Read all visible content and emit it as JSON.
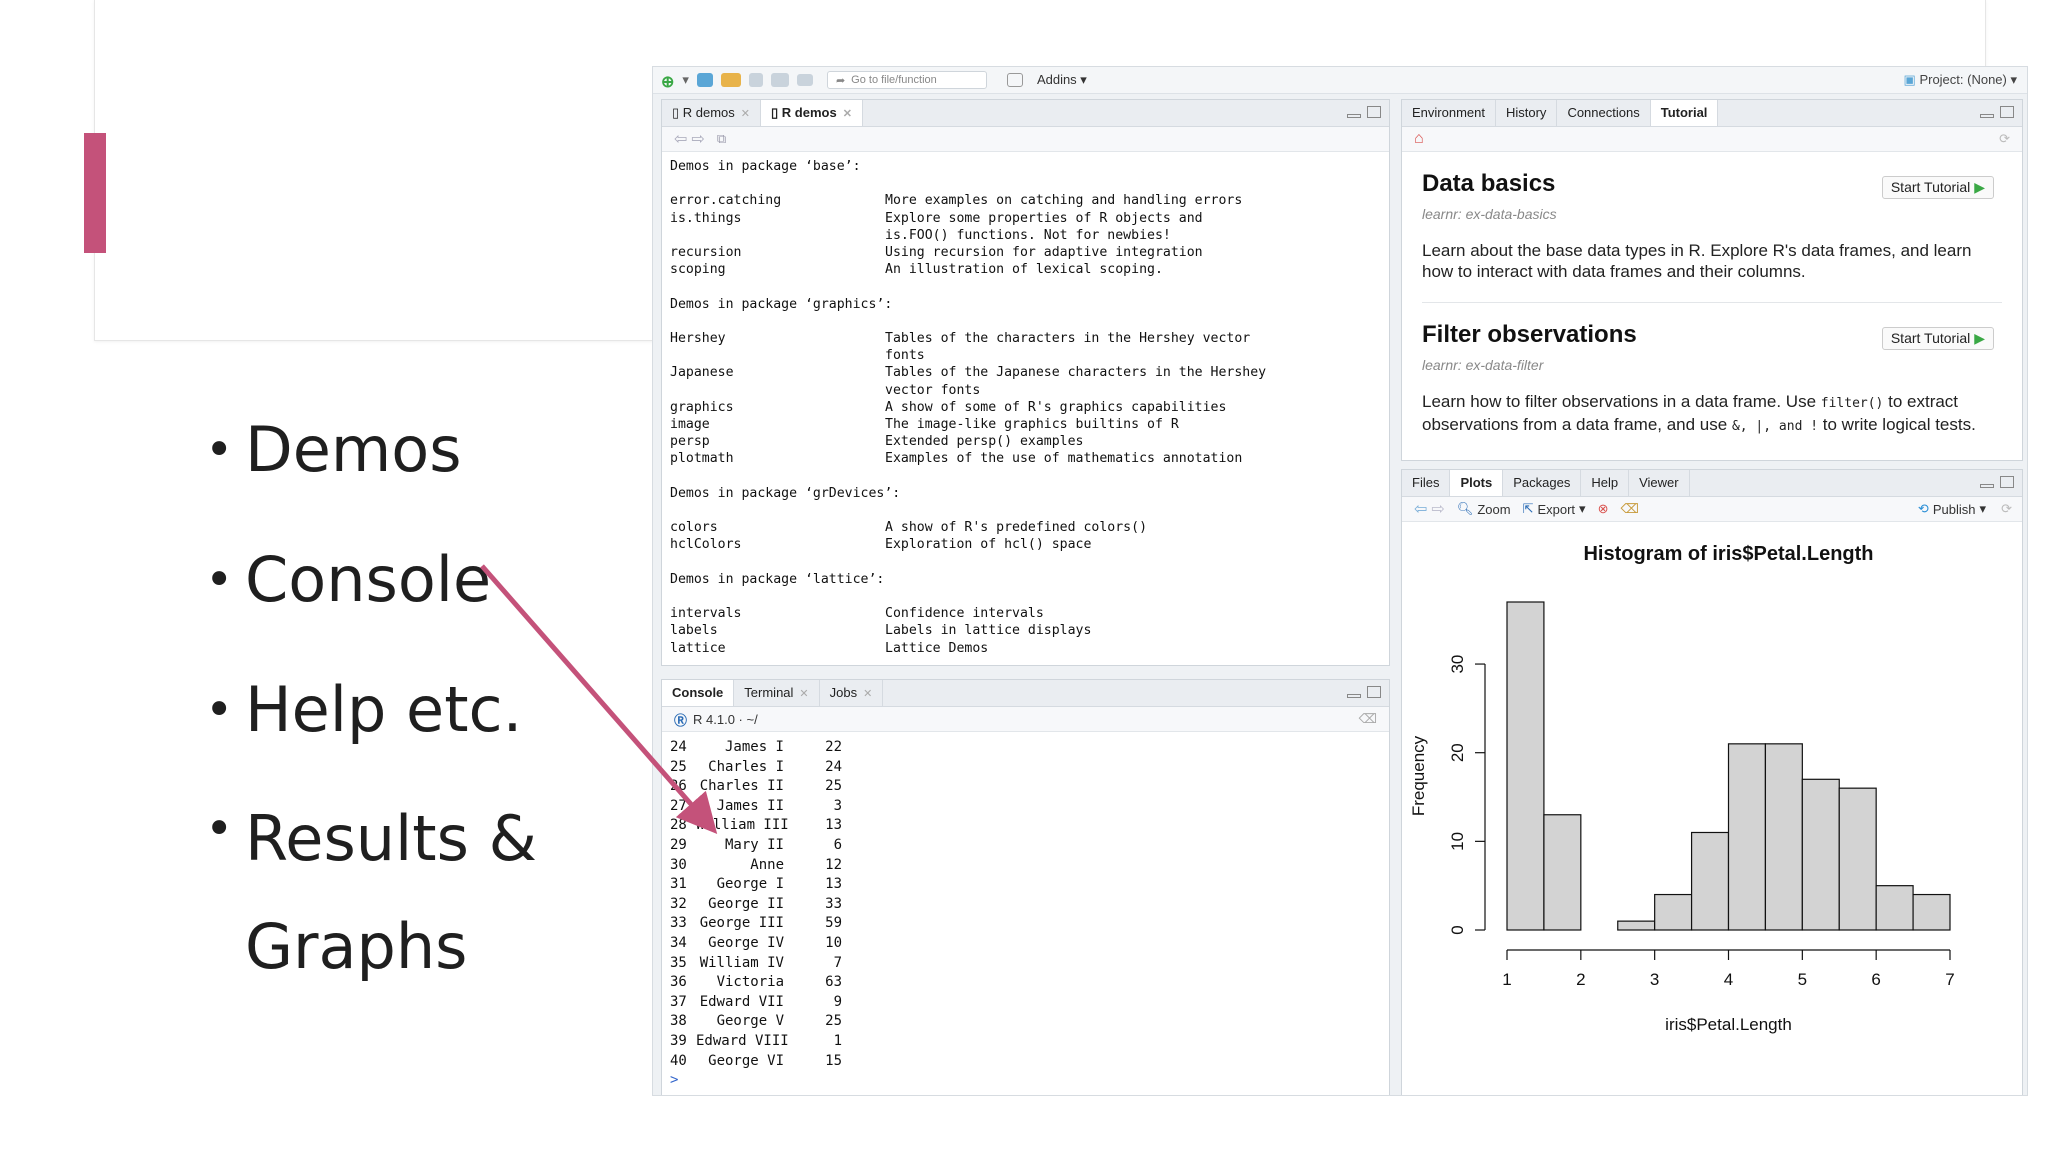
{
  "slide": {
    "bullets": [
      "Demos",
      "Console",
      "Help etc.",
      "Results &",
      "Graphs"
    ],
    "accent_color": "#c4527a"
  },
  "toolbar": {
    "goto_placeholder": "Go to file/function",
    "addins_label": "Addins",
    "project_label": "Project: (None)"
  },
  "source_pane": {
    "tabs": [
      "R demos",
      "R demos"
    ],
    "sections": [
      {
        "heading": "Demos in package ‘base’:",
        "rows": [
          {
            "name": "error.catching",
            "desc": "More examples on catching and handling errors"
          },
          {
            "name": "is.things",
            "desc": "Explore some properties of R objects and\nis.FOO() functions. Not for newbies!"
          },
          {
            "name": "recursion",
            "desc": "Using recursion for adaptive integration"
          },
          {
            "name": "scoping",
            "desc": "An illustration of lexical scoping."
          }
        ]
      },
      {
        "heading": "Demos in package ‘graphics’:",
        "rows": [
          {
            "name": "Hershey",
            "desc": "Tables of the characters in the Hershey vector\nfonts"
          },
          {
            "name": "Japanese",
            "desc": "Tables of the Japanese characters in the Hershey\nvector fonts"
          },
          {
            "name": "graphics",
            "desc": "A show of some of R's graphics capabilities"
          },
          {
            "name": "image",
            "desc": "The image-like graphics builtins of R"
          },
          {
            "name": "persp",
            "desc": "Extended persp() examples"
          },
          {
            "name": "plotmath",
            "desc": "Examples of the use of mathematics annotation"
          }
        ]
      },
      {
        "heading": "Demos in package ‘grDevices’:",
        "rows": [
          {
            "name": "colors",
            "desc": "A show of R's predefined colors()"
          },
          {
            "name": "hclColors",
            "desc": "Exploration of hcl() space"
          }
        ]
      },
      {
        "heading": "Demos in package ‘lattice’:",
        "rows": [
          {
            "name": "intervals",
            "desc": "Confidence intervals"
          },
          {
            "name": "labels",
            "desc": "Labels in lattice displays"
          },
          {
            "name": "lattice",
            "desc": "Lattice Demos"
          }
        ]
      }
    ]
  },
  "console_pane": {
    "tabs": [
      "Console",
      "Terminal",
      "Jobs"
    ],
    "version": "R 4.1.0 · ~/",
    "rows": [
      {
        "i": "24",
        "name": "James I",
        "v": "22"
      },
      {
        "i": "25",
        "name": "Charles I",
        "v": "24"
      },
      {
        "i": "26",
        "name": "Charles II",
        "v": "25"
      },
      {
        "i": "27",
        "name": "James II",
        "v": "3"
      },
      {
        "i": "28",
        "name": "William III",
        "v": "13"
      },
      {
        "i": "29",
        "name": "Mary II",
        "v": "6"
      },
      {
        "i": "30",
        "name": "Anne",
        "v": "12"
      },
      {
        "i": "31",
        "name": "George I",
        "v": "13"
      },
      {
        "i": "32",
        "name": "George II",
        "v": "33"
      },
      {
        "i": "33",
        "name": "George III",
        "v": "59"
      },
      {
        "i": "34",
        "name": "George IV",
        "v": "10"
      },
      {
        "i": "35",
        "name": "William IV",
        "v": "7"
      },
      {
        "i": "36",
        "name": "Victoria",
        "v": "63"
      },
      {
        "i": "37",
        "name": "Edward VII",
        "v": "9"
      },
      {
        "i": "38",
        "name": "George V",
        "v": "25"
      },
      {
        "i": "39",
        "name": "Edward VIII",
        "v": "1"
      },
      {
        "i": "40",
        "name": "George VI",
        "v": "15"
      }
    ],
    "prompt": ">"
  },
  "tutorial_pane": {
    "tabs": [
      "Environment",
      "History",
      "Connections",
      "Tutorial"
    ],
    "items": [
      {
        "title": "Data basics",
        "sub": "learnr: ex-data-basics",
        "desc": "Learn about the base data types in R. Explore R's data frames, and learn how to interact with data frames and their columns.",
        "button": "Start Tutorial"
      },
      {
        "title": "Filter observations",
        "sub": "learnr: ex-data-filter",
        "desc_a": "Learn how to filter observations in a data frame. Use ",
        "code_a": "filter()",
        "desc_b": " to extract observations from a data frame, and use ",
        "code_b": "&, |, and !",
        "desc_c": " to write logical tests.",
        "button": "Start Tutorial"
      }
    ]
  },
  "plots_pane": {
    "tabs": [
      "Files",
      "Plots",
      "Packages",
      "Help",
      "Viewer"
    ],
    "zoom_label": "Zoom",
    "export_label": "Export",
    "publish_label": "Publish"
  },
  "chart_data": {
    "type": "bar",
    "title": "Histogram of iris$Petal.Length",
    "xlabel": "iris$Petal.Length",
    "ylabel": "Frequency",
    "bins": [
      [
        1,
        1.5
      ],
      [
        1.5,
        2
      ],
      [
        2,
        2.5
      ],
      [
        2.5,
        3
      ],
      [
        3,
        3.5
      ],
      [
        3.5,
        4
      ],
      [
        4,
        4.5
      ],
      [
        4.5,
        5
      ],
      [
        5,
        5.5
      ],
      [
        5.5,
        6
      ],
      [
        6,
        6.5
      ],
      [
        6.5,
        7
      ]
    ],
    "values": [
      37,
      13,
      0,
      1,
      4,
      11,
      21,
      21,
      17,
      16,
      5,
      4
    ],
    "xticks": [
      1,
      2,
      3,
      4,
      5,
      6,
      7
    ],
    "yticks": [
      0,
      10,
      20,
      30
    ],
    "xlim": [
      1,
      7
    ],
    "ylim": [
      0,
      37
    ],
    "bar_color": "#d3d3d3"
  }
}
